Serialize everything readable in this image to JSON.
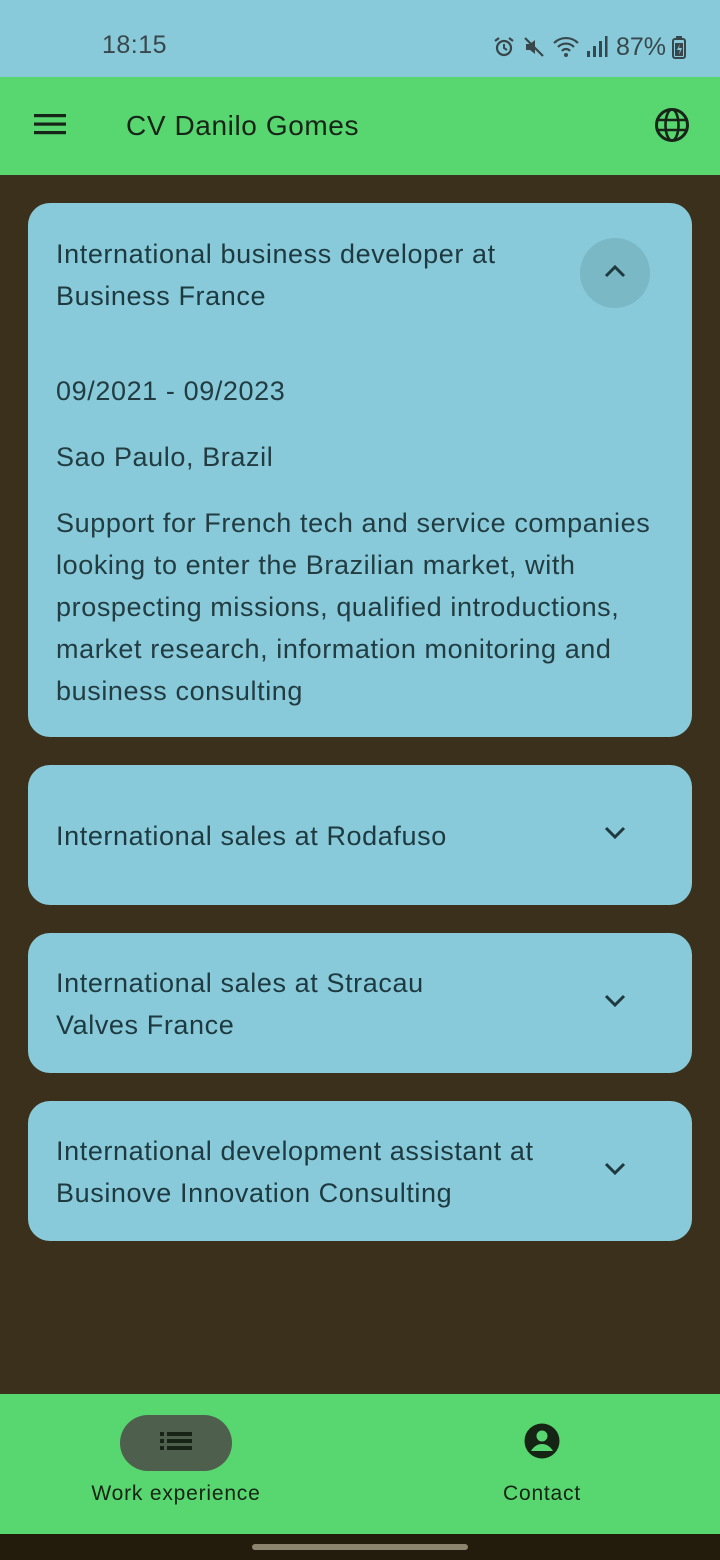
{
  "status_bar": {
    "time": "18:15",
    "battery": "87%",
    "icons": [
      "alarm-icon",
      "mute-icon",
      "wifi-icon",
      "signal-icon",
      "battery-icon"
    ]
  },
  "app_bar": {
    "title": "CV Danilo Gomes",
    "menu_icon": "menu-icon",
    "language_icon": "globe-icon"
  },
  "experiences": [
    {
      "title": "International business developer at Business France",
      "expanded": true,
      "dates": "09/2021 - 09/2023",
      "location": "Sao Paulo, Brazil",
      "description": "Support for French tech and service companies looking to enter the Brazilian market, with prospecting missions, qualified introductions, market research, information monitoring and business consulting"
    },
    {
      "title": "International sales at Rodafuso",
      "expanded": false
    },
    {
      "title": "International sales at Stracau Valves France",
      "expanded": false
    },
    {
      "title": "International development assistant at Businove Innovation Consulting",
      "expanded": false
    }
  ],
  "bottom_nav": {
    "items": [
      {
        "label": "Work experience",
        "icon": "list-icon",
        "active": true
      },
      {
        "label": "Contact",
        "icon": "account-circle-icon",
        "active": false
      }
    ]
  },
  "colors": {
    "status_bar": "#88cad9",
    "app_bar": "#58d66f",
    "background": "#3b301b",
    "card": "#88cad9",
    "nav_active_pill": "#4e5f4d"
  }
}
